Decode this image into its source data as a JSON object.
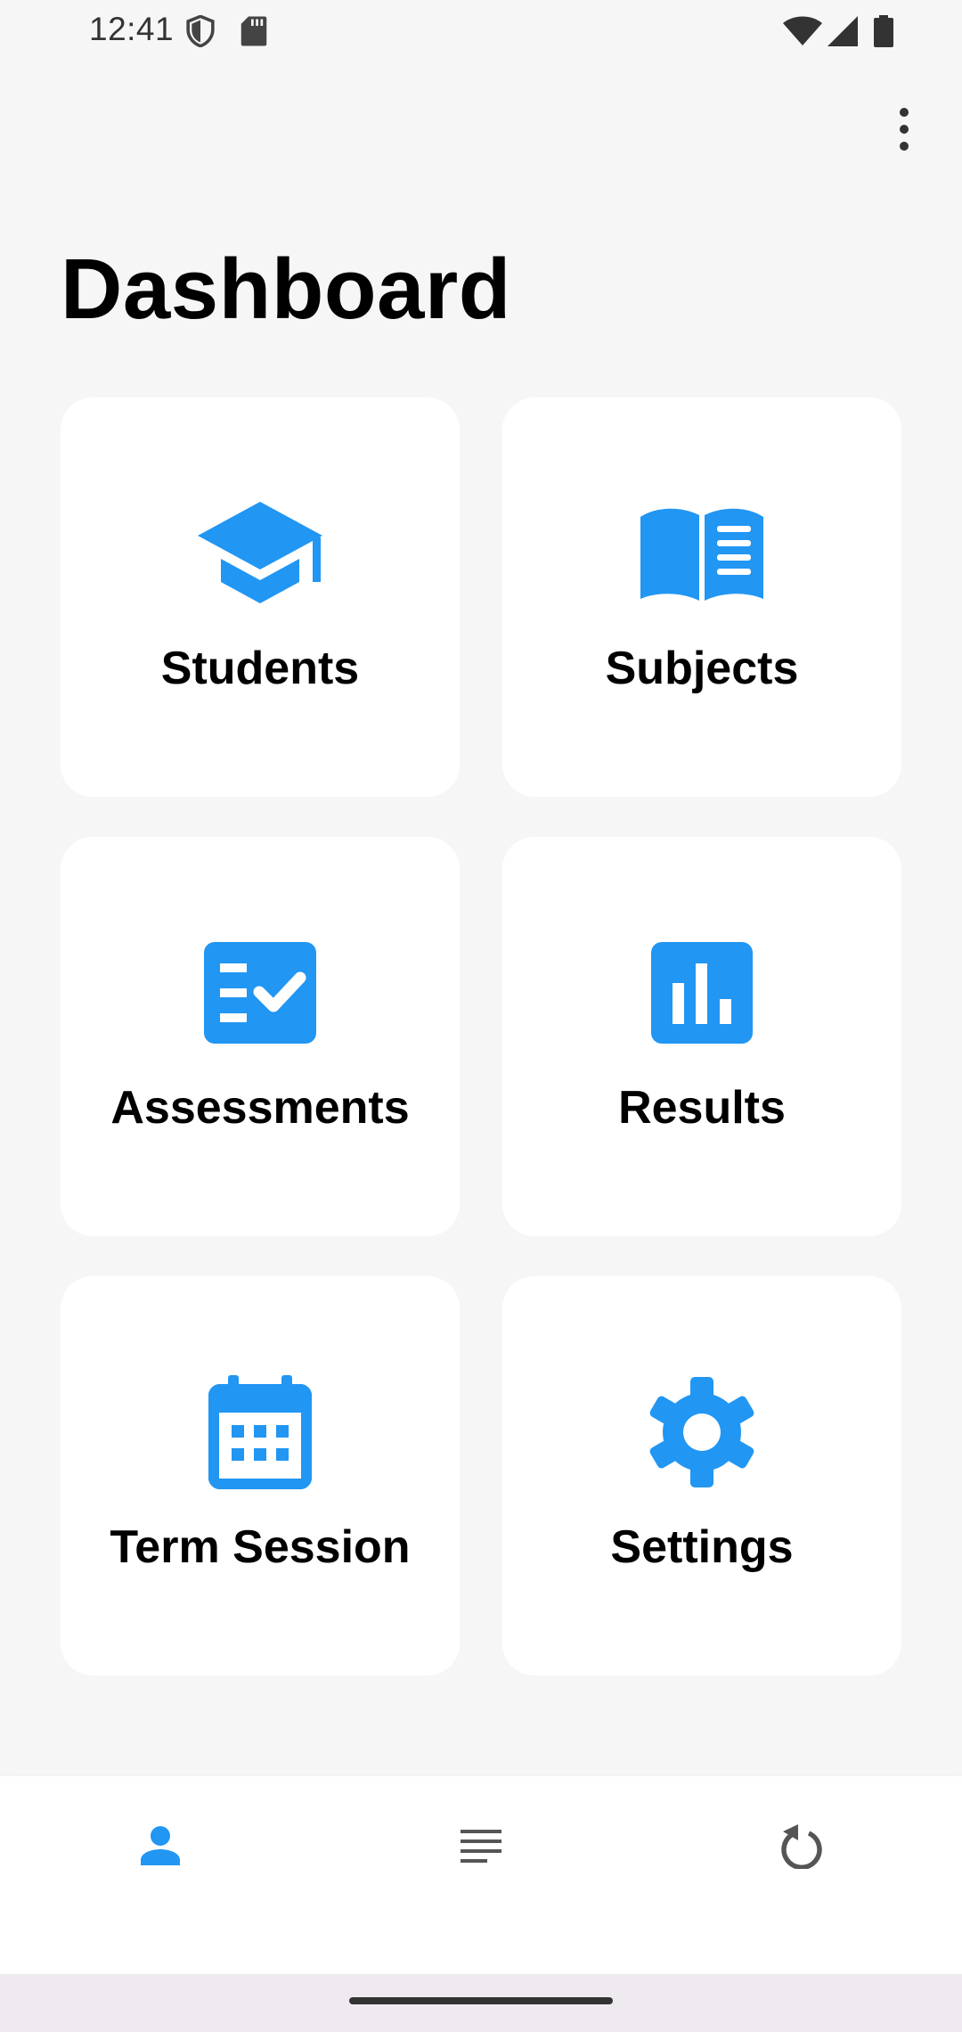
{
  "status_bar": {
    "time": "12:41",
    "left_icons": [
      "shield-icon",
      "sd-card-icon"
    ],
    "right_icons": [
      "wifi-icon",
      "signal-icon",
      "battery-icon"
    ]
  },
  "app_bar": {
    "overflow_icon": "more-vert-icon"
  },
  "page": {
    "title": "Dashboard"
  },
  "cards": [
    {
      "label": "Students",
      "icon": "graduation-cap-icon"
    },
    {
      "label": "Subjects",
      "icon": "book-icon"
    },
    {
      "label": "Assessments",
      "icon": "checklist-icon"
    },
    {
      "label": "Results",
      "icon": "bar-chart-icon"
    },
    {
      "label": "Term Session",
      "icon": "calendar-icon"
    },
    {
      "label": "Settings",
      "icon": "gear-icon"
    }
  ],
  "bottom_nav": {
    "items": [
      {
        "icon": "person-icon",
        "selected": true
      },
      {
        "icon": "list-icon",
        "selected": false
      },
      {
        "icon": "refresh-icon",
        "selected": false
      }
    ]
  },
  "colors": {
    "accent": "#2196f3",
    "background": "#f6f6f6",
    "card": "#ffffff",
    "text": "#000000",
    "icon_inactive": "#555555"
  }
}
